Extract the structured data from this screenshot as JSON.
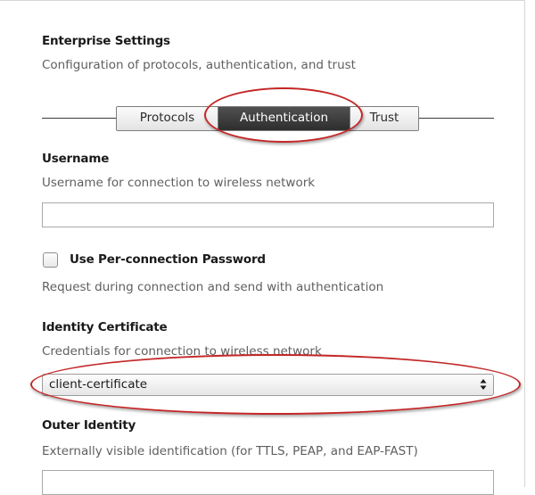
{
  "enterprise": {
    "title": "Enterprise Settings",
    "description": "Configuration of protocols, authentication, and trust"
  },
  "tabs": [
    {
      "label": "Protocols",
      "active": false
    },
    {
      "label": "Authentication",
      "active": true
    },
    {
      "label": "Trust",
      "active": false
    }
  ],
  "username": {
    "title": "Username",
    "description": "Username for connection to wireless network",
    "value": ""
  },
  "per_connection_password": {
    "label": "Use Per-connection Password",
    "checked": false,
    "description": "Request during connection and send with authentication"
  },
  "identity_certificate": {
    "title": "Identity Certificate",
    "description": "Credentials for connection to wireless network",
    "selected": "client-certificate"
  },
  "outer_identity": {
    "title": "Outer Identity",
    "description": "Externally visible identification (for TTLS, PEAP, and EAP-FAST)",
    "value": ""
  },
  "colors": {
    "highlight": "#c42626",
    "active_tab": "#3a3a3a"
  }
}
